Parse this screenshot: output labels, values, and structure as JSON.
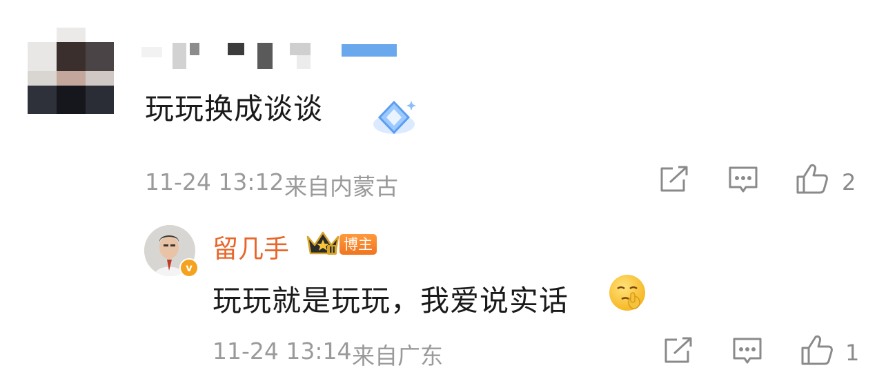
{
  "comment": {
    "text": "玩玩换成谈谈",
    "timestamp": "11-24 13:12",
    "location": "来自内蒙古",
    "like_count": "2",
    "icons": [
      "share-icon",
      "reply-icon",
      "like-icon"
    ]
  },
  "reply": {
    "username": "留几手",
    "crown_badge": "II",
    "role_badge": "博主",
    "text": "玩玩就是玩玩，我爱说实话",
    "emoji": "shush-emoji",
    "timestamp": "11-24 13:14",
    "location": "来自广东",
    "like_count": "1",
    "icons": [
      "share-icon",
      "reply-icon",
      "like-icon"
    ]
  },
  "colors": {
    "username": "#e8662a",
    "meta": "#9a9a9a",
    "icon": "#8a8a8a",
    "badge": "#f07520"
  }
}
